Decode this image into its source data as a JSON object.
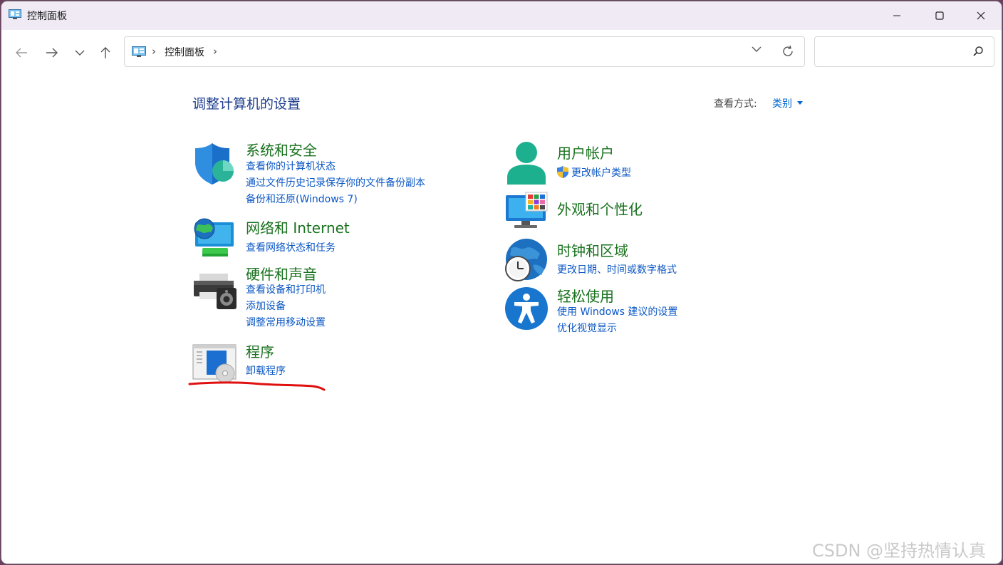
{
  "window": {
    "title": "控制面板"
  },
  "address_bar": {
    "crumb": "控制面板",
    "separator": "›"
  },
  "search": {
    "placeholder": ""
  },
  "header": {
    "title": "调整计算机的设置",
    "view_by_label": "查看方式:",
    "view_by_value": "类别"
  },
  "categories": {
    "system_security": {
      "title": "系统和安全",
      "links": [
        "查看你的计算机状态",
        "通过文件历史记录保存你的文件备份副本",
        "备份和还原(Windows 7)"
      ]
    },
    "network": {
      "title": "网络和 Internet",
      "links": [
        "查看网络状态和任务"
      ]
    },
    "hardware": {
      "title": "硬件和声音",
      "links": [
        "查看设备和打印机",
        "添加设备",
        "调整常用移动设置"
      ]
    },
    "programs": {
      "title": "程序",
      "links": [
        "卸载程序"
      ]
    },
    "user_accounts": {
      "title": "用户帐户",
      "links": [
        "更改帐户类型"
      ]
    },
    "appearance": {
      "title": "外观和个性化",
      "links": []
    },
    "clock_region": {
      "title": "时钟和区域",
      "links": [
        "更改日期、时间或数字格式"
      ]
    },
    "ease_access": {
      "title": "轻松使用",
      "links": [
        "使用 Windows 建议的设置",
        "优化视觉显示"
      ]
    }
  },
  "colors": {
    "title_green": "#19721e",
    "link_blue": "#0b57c4",
    "heading_blue": "#1e3d8f",
    "annotation_red": "#e01010"
  },
  "watermark": "CSDN @坚持热情认真"
}
